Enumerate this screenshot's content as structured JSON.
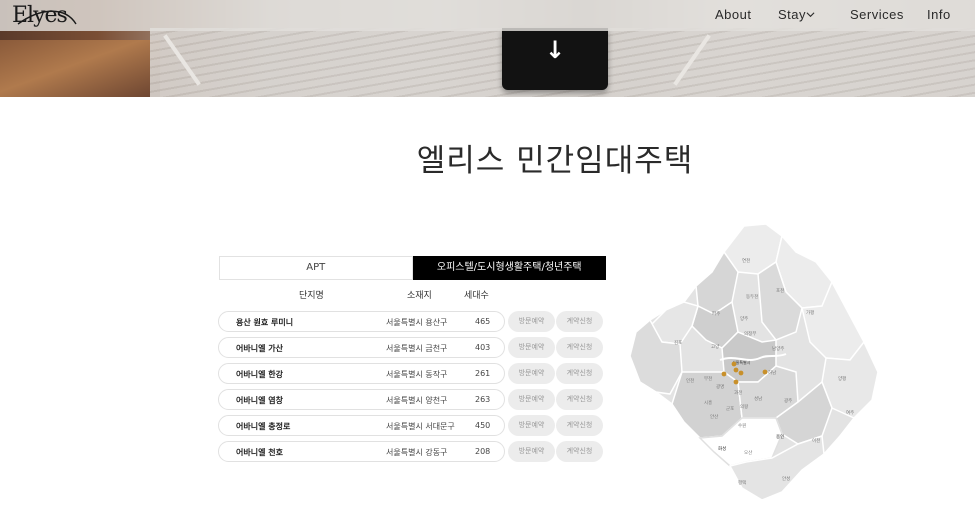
{
  "nav": {
    "logo": "Elyes",
    "links": [
      "About",
      "Stay",
      "Services",
      "Info"
    ]
  },
  "page": {
    "title": "엘리스 민간임대주택"
  },
  "tabs": [
    {
      "label": "APT",
      "active": false
    },
    {
      "label": "오피스텔/도시형생활주택/청년주택",
      "active": true
    }
  ],
  "table": {
    "headers": [
      "단지명",
      "소재지",
      "세대수"
    ],
    "visit_label": "방문예약",
    "contract_label": "계약신청",
    "rows": [
      {
        "name": "용산 원효 루미니",
        "location": "서울특별시 용산구",
        "units": "465"
      },
      {
        "name": "어바니엘 가산",
        "location": "서울특별시 금천구",
        "units": "403"
      },
      {
        "name": "어바니엘 한강",
        "location": "서울특별시 동작구",
        "units": "261"
      },
      {
        "name": "어바니엘 염창",
        "location": "서울특별시 양천구",
        "units": "263"
      },
      {
        "name": "어바니엘 충정로",
        "location": "서울특별시 서대문구",
        "units": "450"
      },
      {
        "name": "어바니엘 천호",
        "location": "서울특별시 강동구",
        "units": "208"
      }
    ]
  },
  "map": {
    "accent": "#c8902a",
    "labels": [
      "연천",
      "포천",
      "동두천",
      "파주",
      "양주",
      "가평",
      "의정부",
      "고양",
      "남양주",
      "김포",
      "서울특별시",
      "양평",
      "인천",
      "부천",
      "하남",
      "광명",
      "시흥",
      "과천",
      "성남",
      "광주",
      "안산",
      "군포",
      "의왕",
      "여주",
      "수원",
      "용인",
      "이천",
      "화성",
      "오산",
      "평택",
      "안성"
    ]
  },
  "colors": {
    "active_tab": "#000000",
    "pill_bg": "#ececec",
    "pill_text": "#9a9a9a"
  }
}
